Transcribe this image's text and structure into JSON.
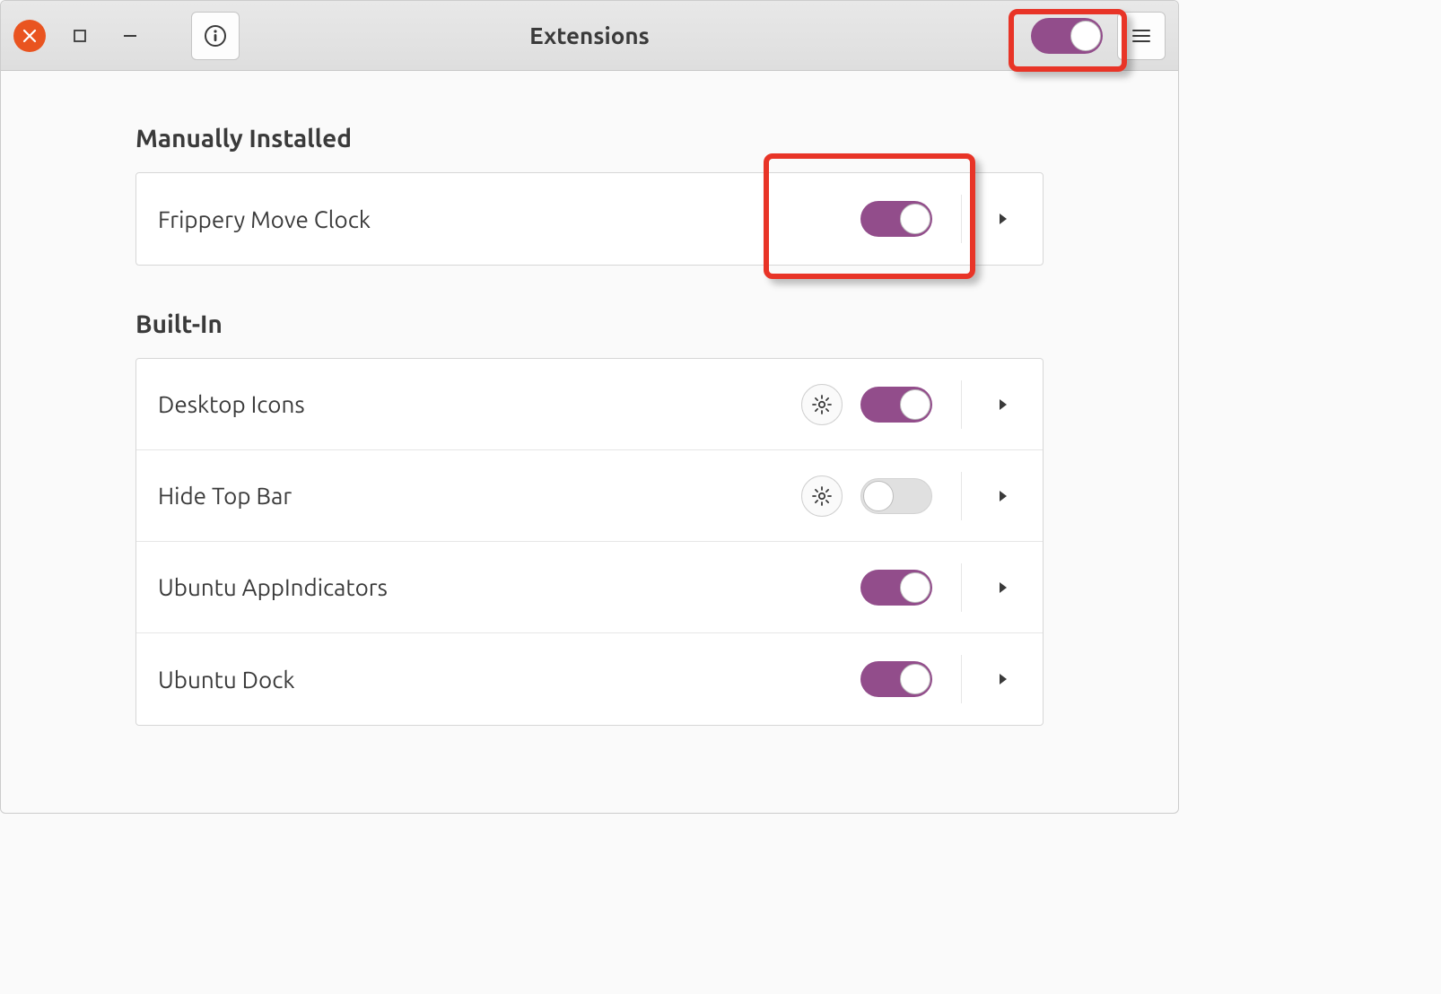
{
  "window": {
    "title": "Extensions",
    "master_toggle_on": true
  },
  "sections": {
    "manual": {
      "heading": "Manually Installed",
      "items": [
        {
          "name": "Frippery Move Clock",
          "enabled": true,
          "has_settings": false
        }
      ]
    },
    "builtin": {
      "heading": "Built-In",
      "items": [
        {
          "name": "Desktop Icons",
          "enabled": true,
          "has_settings": true
        },
        {
          "name": "Hide Top Bar",
          "enabled": false,
          "has_settings": true
        },
        {
          "name": "Ubuntu AppIndicators",
          "enabled": true,
          "has_settings": false
        },
        {
          "name": "Ubuntu Dock",
          "enabled": true,
          "has_settings": false
        }
      ]
    }
  },
  "colors": {
    "accent": "#924d8b",
    "close": "#e95420",
    "annotation": "#e83427"
  }
}
